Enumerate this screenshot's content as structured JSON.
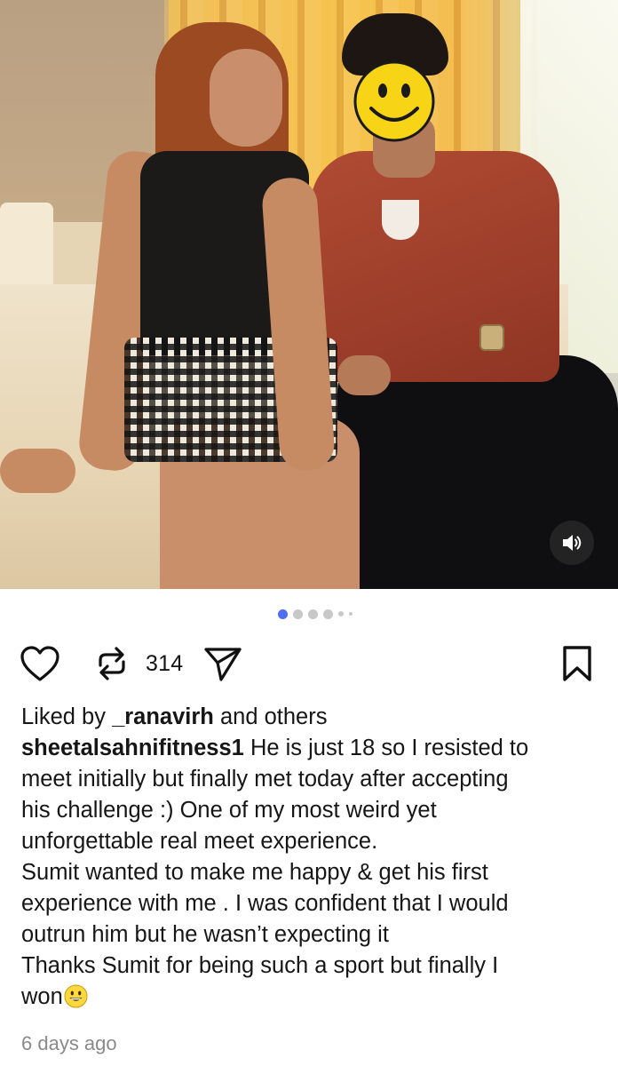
{
  "post": {
    "repost_count": "314",
    "liked_by": {
      "prefix": "Liked by ",
      "user": "_ranavirh",
      "suffix": " and others"
    },
    "caption": {
      "username": "sheetalsahnifitness1",
      "lines": [
        " He is just 18 so I resisted to",
        "meet initially but finally met today after accepting",
        "his challenge :) One of my most weird yet",
        "unforgettable real meet experience.",
        "Sumit wanted  to make me happy & get his first",
        "experience with me .  I was confident that I would",
        "outrun him but he wasn’t expecting it",
        "Thanks  Sumit for being such a sport but finally I",
        "won"
      ]
    },
    "time_ago": "6 days ago",
    "carousel": {
      "total_dots": 6,
      "active_index": 0
    }
  },
  "icons": {
    "like": "heart-icon",
    "repost": "repost-icon",
    "share": "send-icon",
    "save": "bookmark-icon",
    "sound": "speaker-icon",
    "caption_emoji": "grinning-face-emoji",
    "face_cover": "smiley-face-sticker"
  },
  "colors": {
    "active_dot": "#4f6cf5",
    "inactive_dot": "#c8c8c8",
    "secondary_text": "#8a8a8a"
  }
}
